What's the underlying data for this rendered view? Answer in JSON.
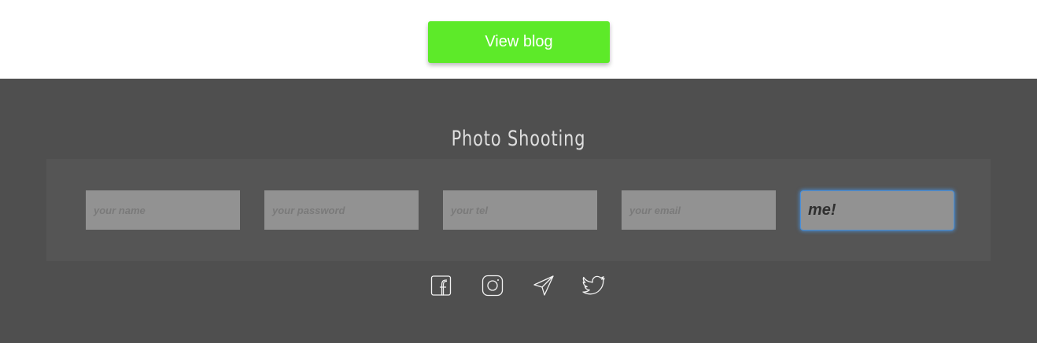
{
  "top": {
    "view_blog_label": "View blog"
  },
  "footer": {
    "title": "Photo Shooting",
    "form": {
      "name_placeholder": "your name",
      "password_placeholder": "your password",
      "tel_placeholder": "your tel",
      "email_placeholder": "your email",
      "submit_label": "me!"
    },
    "socials": [
      {
        "icon": "facebook-icon"
      },
      {
        "icon": "instagram-icon"
      },
      {
        "icon": "telegram-icon"
      },
      {
        "icon": "twitter-icon"
      }
    ]
  },
  "colors": {
    "button_green": "#5dea29",
    "footer_bg": "#4f4f4f",
    "form_panel_bg": "#555555",
    "field_bg": "#929292",
    "focus_blue": "#4a90d9"
  }
}
